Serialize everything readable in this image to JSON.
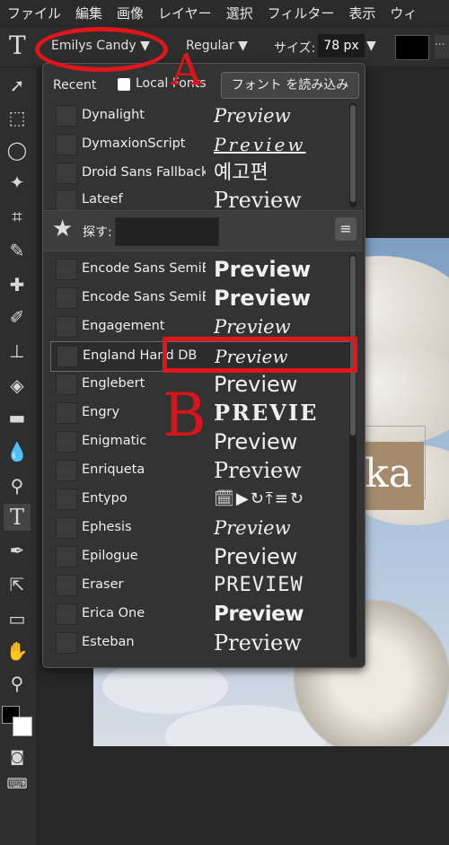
{
  "menu": [
    "ファイル",
    "編集",
    "画像",
    "レイヤー",
    "選択",
    "フィルター",
    "表示",
    "ウィ"
  ],
  "options": {
    "tool_glyph": "T",
    "font_name": "Emilys Candy ▼",
    "font_style": "Regular ▼",
    "size_label": "サイズ:",
    "size_value": "78 px",
    "size_arrow": "▼",
    "more": "..."
  },
  "panel": {
    "tab_recent": "Recent",
    "tab_local": "Local Fonts",
    "load_button": "フォント を読み込み",
    "find_label": "探す:",
    "find_value": "",
    "list_icon": "≡",
    "recent_fonts": [
      {
        "name": "Dynalight",
        "preview": "Preview"
      },
      {
        "name": "DymaxionScript",
        "preview": "Preview"
      },
      {
        "name": "Droid Sans Fallback",
        "preview": "예고편"
      },
      {
        "name": "Lateef",
        "preview": "Preview"
      }
    ],
    "fonts": [
      {
        "name": "Encode Sans SemiE",
        "preview": "Preview"
      },
      {
        "name": "Encode Sans SemiE",
        "preview": "Preview"
      },
      {
        "name": "Engagement",
        "preview": "Preview"
      },
      {
        "name": "England Hand DB",
        "preview": "Preview"
      },
      {
        "name": "Englebert",
        "preview": "Preview"
      },
      {
        "name": "Engry",
        "preview": "PREVIE"
      },
      {
        "name": "Enigmatic",
        "preview": "Preview"
      },
      {
        "name": "Enriqueta",
        "preview": "Preview"
      },
      {
        "name": "Entypo",
        "preview": "🗓▶↻⤒≡↻"
      },
      {
        "name": "Ephesis",
        "preview": "Preview"
      },
      {
        "name": "Epilogue",
        "preview": "Preview"
      },
      {
        "name": "Eraser",
        "preview": "PREVIEW"
      },
      {
        "name": "Erica One",
        "preview": "Preview"
      },
      {
        "name": "Esteban",
        "preview": "Preview"
      }
    ]
  },
  "canvas": {
    "text_layer": "ka"
  },
  "annotations": {
    "label_a": "A",
    "label_b": "B",
    "color": "#e0161b"
  },
  "tools": [
    "select-arrow-icon",
    "marquee-icon",
    "lasso-icon",
    "magic-wand-icon",
    "crop-icon",
    "eyedropper-icon",
    "healing-icon",
    "brush-icon",
    "stamp-icon",
    "eraser-icon",
    "gradient-icon",
    "blur-drop-icon",
    "dodge-icon",
    "text-tool-icon",
    "pen-icon",
    "path-select-icon",
    "shape-icon",
    "hand-icon",
    "zoom-icon"
  ]
}
